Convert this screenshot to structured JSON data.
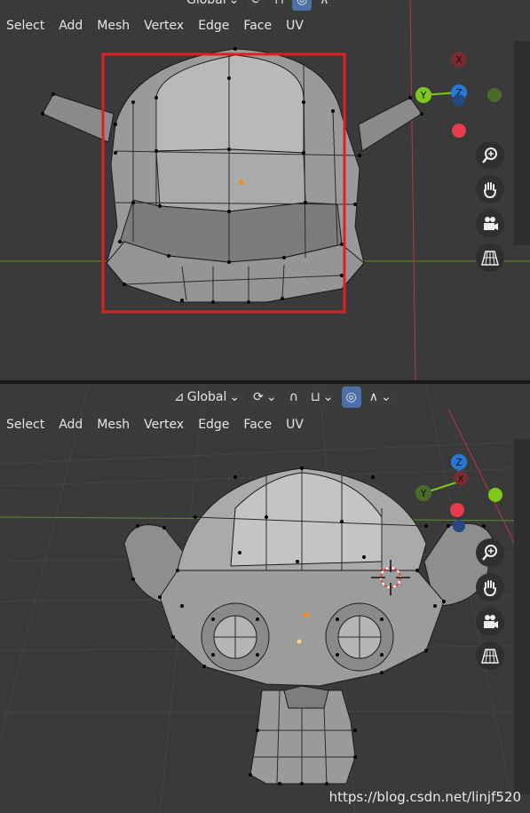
{
  "menus": {
    "select": "Select",
    "add": "Add",
    "mesh": "Mesh",
    "vertex": "Vertex",
    "edge": "Edge",
    "face": "Face",
    "uv": "UV"
  },
  "toolbar": {
    "transform_orientation": "Global"
  },
  "gizmo": {
    "x_label": "X",
    "y_label": "Y",
    "z_label": "Z"
  },
  "colors": {
    "x_axis": "#e63c4b",
    "y_axis": "#7ec81e",
    "z_axis": "#2a78d6",
    "selection_box": "#e0201e",
    "grid_line": "#5c8c2c"
  },
  "icons": {
    "zoom": "zoom-icon",
    "pan": "hand-icon",
    "camera": "camera-icon",
    "grid": "perspective-grid-icon"
  },
  "watermark": "https://blog.csdn.net/linjf520"
}
